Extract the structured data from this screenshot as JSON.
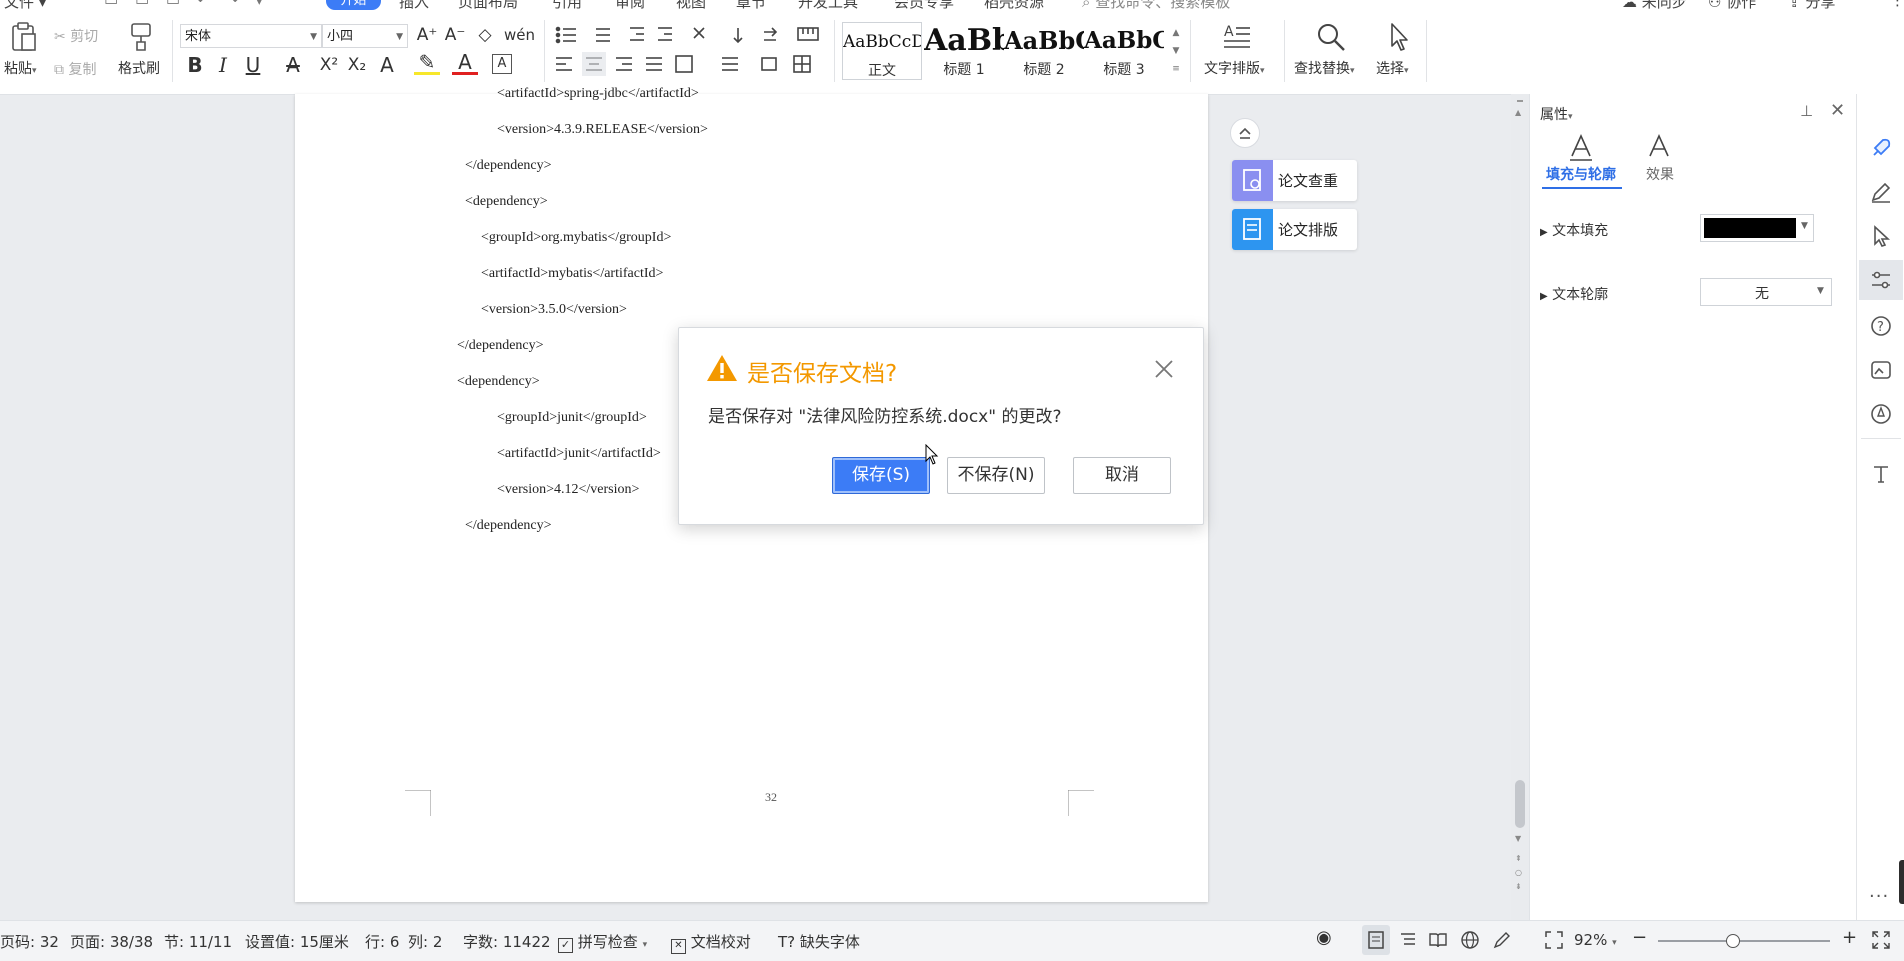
{
  "ribbon": {
    "menubar": [
      "文件",
      "开始",
      "插入",
      "页面布局",
      "引用",
      "审阅",
      "视图",
      "章节",
      "开发工具",
      "会员专享",
      "稻壳资源",
      "查找命令、搜索模板",
      "未同步",
      "协作",
      "分享"
    ],
    "active_tab": "开始",
    "paste_label": "粘贴",
    "cut_label": "剪切",
    "copy_label": "复制",
    "format_painter_label": "格式刷",
    "font_name": "宋体",
    "font_size": "小四",
    "styles": [
      {
        "preview": "AaBbCcDd",
        "name": "正文"
      },
      {
        "preview": "AaBb",
        "name": "标题 1"
      },
      {
        "preview": "AaBbC",
        "name": "标题 2"
      },
      {
        "preview": "AaBbC",
        "name": "标题 3"
      }
    ],
    "text_layout_label": "文字排版",
    "find_replace_label": "查找替换",
    "select_label": "选择"
  },
  "document": {
    "code_lines": [
      "<artifactId>spring-jdbc</artifactId>",
      "<version>4.3.9.RELEASE</version>",
      "</dependency>",
      "<dependency>",
      "<groupId>org.mybatis</groupId>",
      "<artifactId>mybatis</artifactId>",
      "<version>3.5.0</version>",
      "</dependency>",
      "<dependency>",
      "<groupId>junit</groupId>",
      "<artifactId>junit</artifactId>",
      "<version>4.12</version>",
      "</dependency>"
    ],
    "page_number": "32"
  },
  "side_cards": {
    "check_label": "论文查重",
    "layout_label": "论文排版"
  },
  "properties_panel": {
    "title": "属性",
    "tab_fill": "填充与轮廓",
    "tab_effect": "效果",
    "text_fill_label": "文本填充",
    "text_fill_color": "#000000",
    "text_outline_label": "文本轮廓",
    "text_outline_value": "无"
  },
  "dialog": {
    "title": "是否保存文档?",
    "message": "是否保存对 \"法律风险防控系统.docx\" 的更改?",
    "save_label": "保存(S)",
    "nosave_label": "不保存(N)",
    "cancel_label": "取消"
  },
  "status_bar": {
    "page_code": "页码: 32",
    "page": "页面: 38/38",
    "section": "节: 11/11",
    "setting": "设置值: 15厘米",
    "row": "行: 6",
    "col": "列: 2",
    "word_count": "字数: 11422",
    "spell_check": "拼写检查",
    "doc_proof": "文档校对",
    "missing_font": "缺失字体",
    "zoom": "92%"
  },
  "colors": {
    "accent": "#3c7cf6",
    "warning": "#f39800",
    "ribbon_bg": "#ffffff",
    "canvas_bg": "#eaecef"
  }
}
